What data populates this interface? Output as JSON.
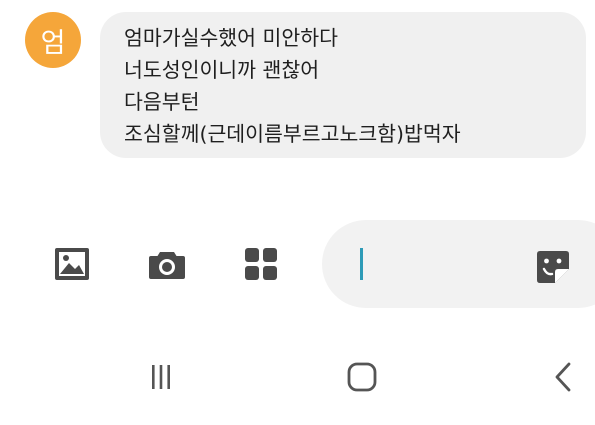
{
  "message": {
    "avatar_initial": "엄",
    "lines": [
      "엄마가실수했어 미안하다",
      "너도성인이니까 괜찮어",
      "다음부턴",
      "조심할께(근데이름부르고노크함)밥먹자"
    ]
  },
  "composer": {
    "icons": [
      "image-icon",
      "camera-icon",
      "apps-grid-icon",
      "sticker-icon"
    ],
    "input_value": ""
  },
  "navbar": {
    "icons": [
      "recent-apps-icon",
      "home-icon",
      "back-icon"
    ]
  },
  "colors": {
    "avatar": "#f5a63a",
    "bubble": "#f0f0f0",
    "input": "#f2f2f2",
    "caret": "#2e9bb7",
    "icon": "#4a4a4a"
  }
}
